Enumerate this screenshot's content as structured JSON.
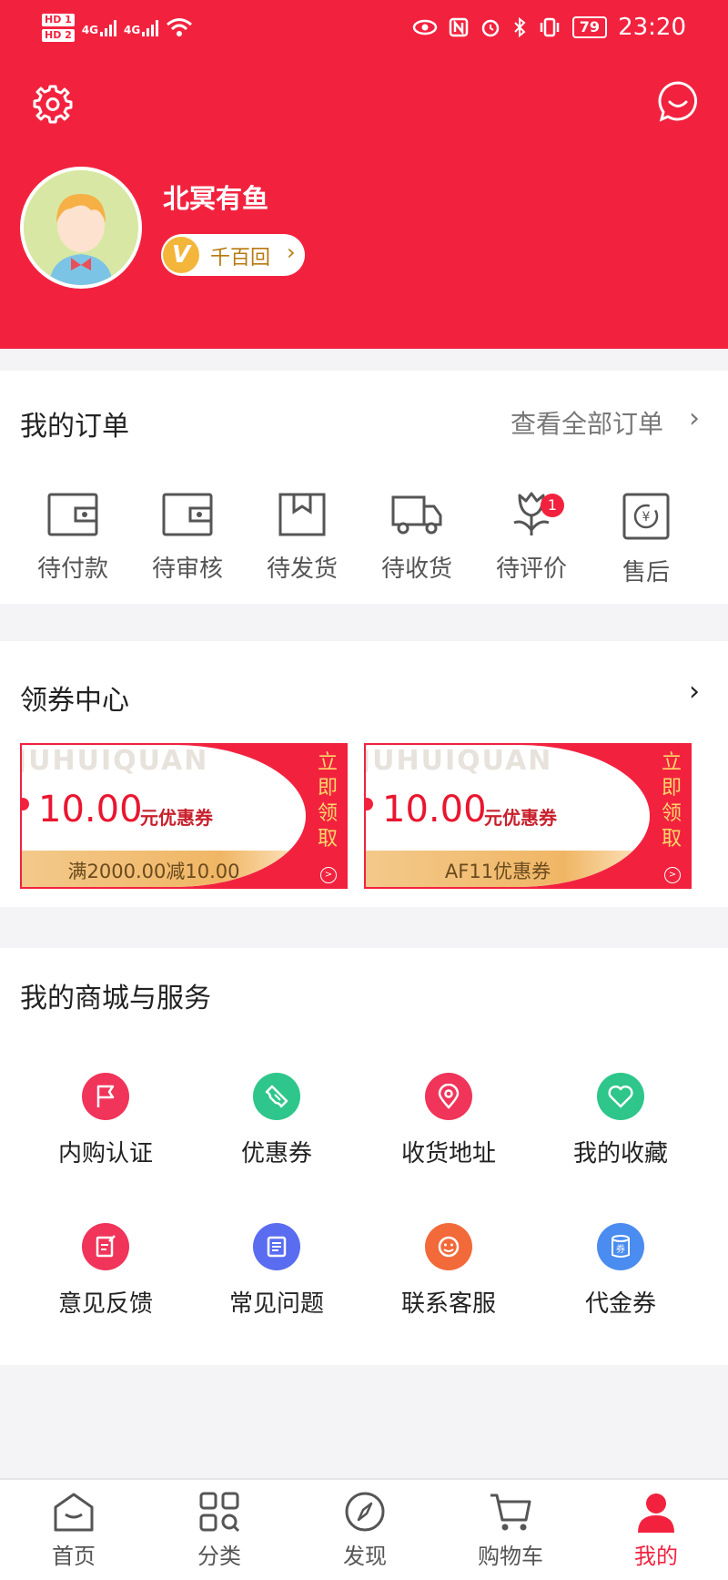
{
  "status_bar": {
    "hd1": "HD 1",
    "hd2": "HD 2",
    "sig1": "4G",
    "sig2": "4G",
    "battery": "79",
    "time": "23:20"
  },
  "header": {
    "settings_icon": "gear-icon",
    "message_icon": "chat-bubble-icon",
    "username": "北冥有鱼",
    "vip_badge": "V",
    "vip_level": "千百回",
    "vip_chevron": "›"
  },
  "orders": {
    "title": "我的订单",
    "view_all": "查看全部订单",
    "chevron": "›",
    "items": [
      {
        "label": "待付款",
        "icon": "wallet-icon"
      },
      {
        "label": "待审核",
        "icon": "wallet-icon"
      },
      {
        "label": "待发货",
        "icon": "box-icon"
      },
      {
        "label": "待收货",
        "icon": "truck-icon"
      },
      {
        "label": "待评价",
        "icon": "flower-icon",
        "badge": "1"
      },
      {
        "label": "售后",
        "icon": "refund-icon",
        "glyph": "¥"
      }
    ]
  },
  "coupons": {
    "title": "领券中心",
    "chevron": "›",
    "items": [
      {
        "watermark": "JUHUIQUAN",
        "amount": "10.00",
        "unit": "元优惠券",
        "condition": "满2000.00减10.00",
        "action": [
          "立",
          "即",
          "领",
          "取"
        ],
        "arrow": ">"
      },
      {
        "watermark": "JUHUIQUAN",
        "amount": "10.00",
        "unit": "元优惠券",
        "condition": "AF11优惠券",
        "action": [
          "立",
          "即",
          "领",
          "取"
        ],
        "arrow": ">"
      }
    ]
  },
  "services": {
    "title": "我的商城与服务",
    "items": [
      {
        "label": "内购认证",
        "icon": "flag-icon",
        "color": "#f0345a"
      },
      {
        "label": "优惠券",
        "icon": "ticket-icon",
        "color": "#2ec68a"
      },
      {
        "label": "收货地址",
        "icon": "location-pin-icon",
        "color": "#f0345a"
      },
      {
        "label": "我的收藏",
        "icon": "heart-icon",
        "color": "#2ec68a"
      },
      {
        "label": "意见反馈",
        "icon": "edit-note-icon",
        "color": "#f0345a"
      },
      {
        "label": "常见问题",
        "icon": "faq-document-icon",
        "color": "#5a6cf0"
      },
      {
        "label": "联系客服",
        "icon": "smile-icon",
        "color": "#f26a3a"
      },
      {
        "label": "代金券",
        "icon": "voucher-icon",
        "color": "#4b8cf0",
        "glyph": "券"
      }
    ]
  },
  "tabbar": {
    "items": [
      {
        "label": "首页",
        "icon": "home-icon"
      },
      {
        "label": "分类",
        "icon": "category-grid-icon"
      },
      {
        "label": "发现",
        "icon": "compass-icon"
      },
      {
        "label": "购物车",
        "icon": "cart-icon"
      },
      {
        "label": "我的",
        "icon": "user-icon",
        "active": true
      }
    ]
  },
  "colors": {
    "brand_red": "#f2223f",
    "vip_gold": "#f3b53a",
    "active_tab": "#f2223f"
  }
}
